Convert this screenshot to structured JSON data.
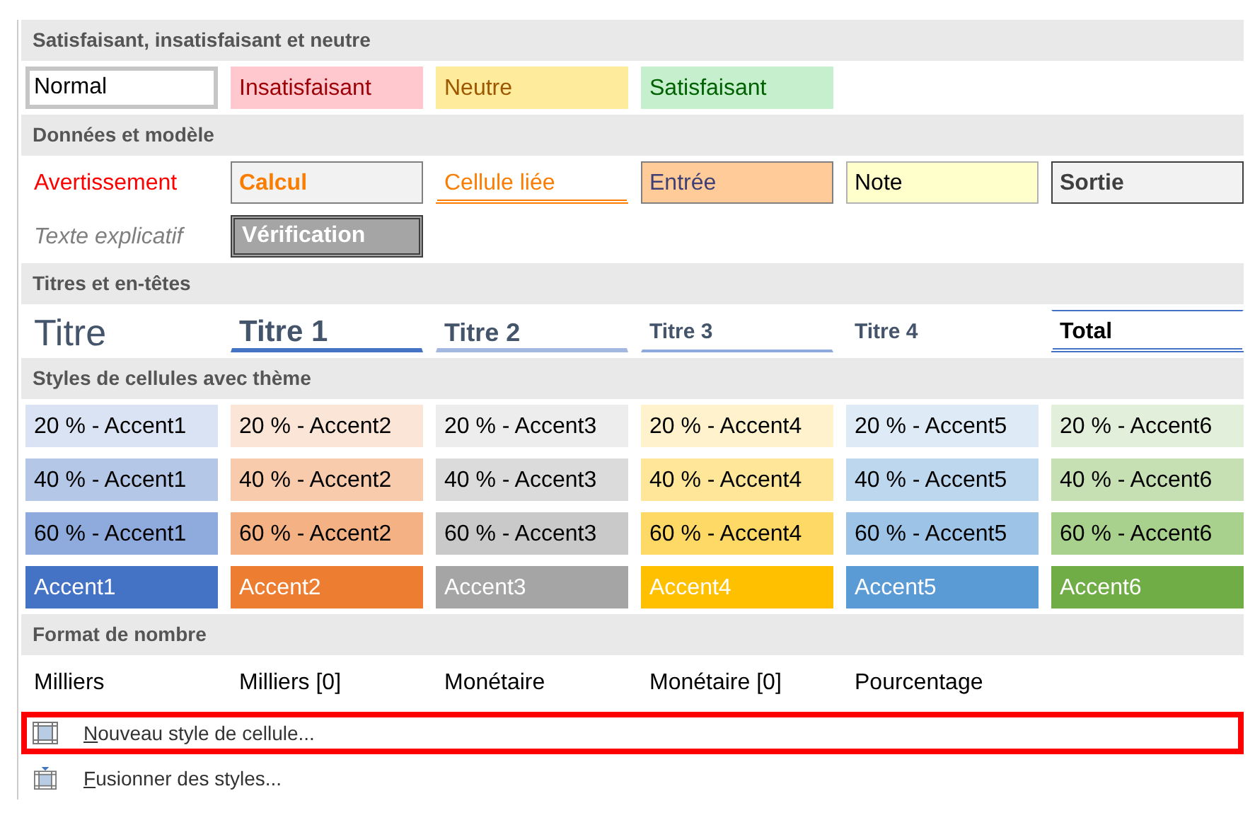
{
  "sections": [
    {
      "title": "Satisfaisant, insatisfaisant et neutre",
      "rows": [
        [
          {
            "label": "Normal",
            "kind": "normal",
            "selected": true
          },
          {
            "label": "Insatisfaisant",
            "kind": "bad",
            "selected": false
          },
          {
            "label": "Neutre",
            "kind": "neutral",
            "selected": false
          },
          {
            "label": "Satisfaisant",
            "kind": "good",
            "selected": false
          }
        ]
      ]
    },
    {
      "title": "Données et modèle",
      "rows": [
        [
          {
            "label": "Avertissement",
            "kind": "warning",
            "selected": false
          },
          {
            "label": "Calcul",
            "kind": "calc",
            "selected": false
          },
          {
            "label": "Cellule liée",
            "kind": "linked",
            "selected": false
          },
          {
            "label": "Entrée",
            "kind": "input",
            "selected": false
          },
          {
            "label": "Note",
            "kind": "note",
            "selected": false
          },
          {
            "label": "Sortie",
            "kind": "output",
            "selected": false
          }
        ],
        [
          {
            "label": "Texte explicatif",
            "kind": "explanatory",
            "selected": false
          },
          {
            "label": "Vérification",
            "kind": "check",
            "selected": false
          }
        ]
      ]
    },
    {
      "title": "Titres et en-têtes",
      "rows": [
        [
          {
            "label": "Titre",
            "kind": "title",
            "selected": false
          },
          {
            "label": "Titre 1",
            "kind": "h1",
            "selected": false
          },
          {
            "label": "Titre 2",
            "kind": "h2",
            "selected": false
          },
          {
            "label": "Titre 3",
            "kind": "h3",
            "selected": false
          },
          {
            "label": "Titre 4",
            "kind": "h4",
            "selected": false
          },
          {
            "label": "Total",
            "kind": "total",
            "selected": false
          }
        ]
      ]
    },
    {
      "title": "Styles de cellules avec thème",
      "rows": [
        [
          {
            "label": "20 % - Accent1",
            "kind": "light",
            "color": "#dae3f3",
            "selected": false
          },
          {
            "label": "20 % - Accent2",
            "kind": "light",
            "color": "#fbe5d6",
            "selected": false
          },
          {
            "label": "20 % - Accent3",
            "kind": "light",
            "color": "#ededed",
            "selected": false
          },
          {
            "label": "20 % - Accent4",
            "kind": "light",
            "color": "#fff2cc",
            "selected": false
          },
          {
            "label": "20 % - Accent5",
            "kind": "light",
            "color": "#deebf7",
            "selected": false
          },
          {
            "label": "20 % - Accent6",
            "kind": "light",
            "color": "#e2efda",
            "selected": false
          }
        ],
        [
          {
            "label": "40 % - Accent1",
            "kind": "light",
            "color": "#b4c7e7",
            "selected": false
          },
          {
            "label": "40 % - Accent2",
            "kind": "light",
            "color": "#f8cbad",
            "selected": false
          },
          {
            "label": "40 % - Accent3",
            "kind": "light",
            "color": "#dbdbdb",
            "selected": false
          },
          {
            "label": "40 % - Accent4",
            "kind": "light",
            "color": "#ffe699",
            "selected": false
          },
          {
            "label": "40 % - Accent5",
            "kind": "light",
            "color": "#bdd7ee",
            "selected": false
          },
          {
            "label": "40 % - Accent6",
            "kind": "light",
            "color": "#c6e0b4",
            "selected": false
          }
        ],
        [
          {
            "label": "60 % - Accent1",
            "kind": "light",
            "color": "#8faadc",
            "selected": false
          },
          {
            "label": "60 % - Accent2",
            "kind": "light",
            "color": "#f4b183",
            "selected": false
          },
          {
            "label": "60 % - Accent3",
            "kind": "light",
            "color": "#c9c9c9",
            "selected": false
          },
          {
            "label": "60 % - Accent4",
            "kind": "light",
            "color": "#ffd966",
            "selected": false
          },
          {
            "label": "60 % - Accent5",
            "kind": "light",
            "color": "#9dc3e6",
            "selected": false
          },
          {
            "label": "60 % - Accent6",
            "kind": "light",
            "color": "#a9d18e",
            "selected": false
          }
        ],
        [
          {
            "label": "Accent1",
            "kind": "solid",
            "color": "#4472c4",
            "selected": false
          },
          {
            "label": "Accent2",
            "kind": "solid",
            "color": "#ed7d31",
            "selected": false
          },
          {
            "label": "Accent3",
            "kind": "solid",
            "color": "#a5a5a5",
            "selected": false
          },
          {
            "label": "Accent4",
            "kind": "solid",
            "color": "#ffc000",
            "selected": false
          },
          {
            "label": "Accent5",
            "kind": "solid",
            "color": "#5b9bd5",
            "selected": false
          },
          {
            "label": "Accent6",
            "kind": "solid",
            "color": "#70ad47",
            "selected": false
          }
        ]
      ]
    },
    {
      "title": "Format de nombre",
      "rows": [
        [
          {
            "label": "Milliers",
            "kind": "number",
            "selected": false
          },
          {
            "label": "Milliers [0]",
            "kind": "number",
            "selected": false
          },
          {
            "label": "Monétaire",
            "kind": "number",
            "selected": false
          },
          {
            "label": "Monétaire [0]",
            "kind": "number",
            "selected": false
          },
          {
            "label": "Pourcentage",
            "kind": "number",
            "selected": false
          }
        ]
      ]
    }
  ],
  "commands": [
    {
      "label": "Nouveau style de cellule...",
      "kind": "new",
      "highlighted": true
    },
    {
      "label": "Fusionner des styles...",
      "kind": "merge",
      "highlighted": false
    }
  ]
}
